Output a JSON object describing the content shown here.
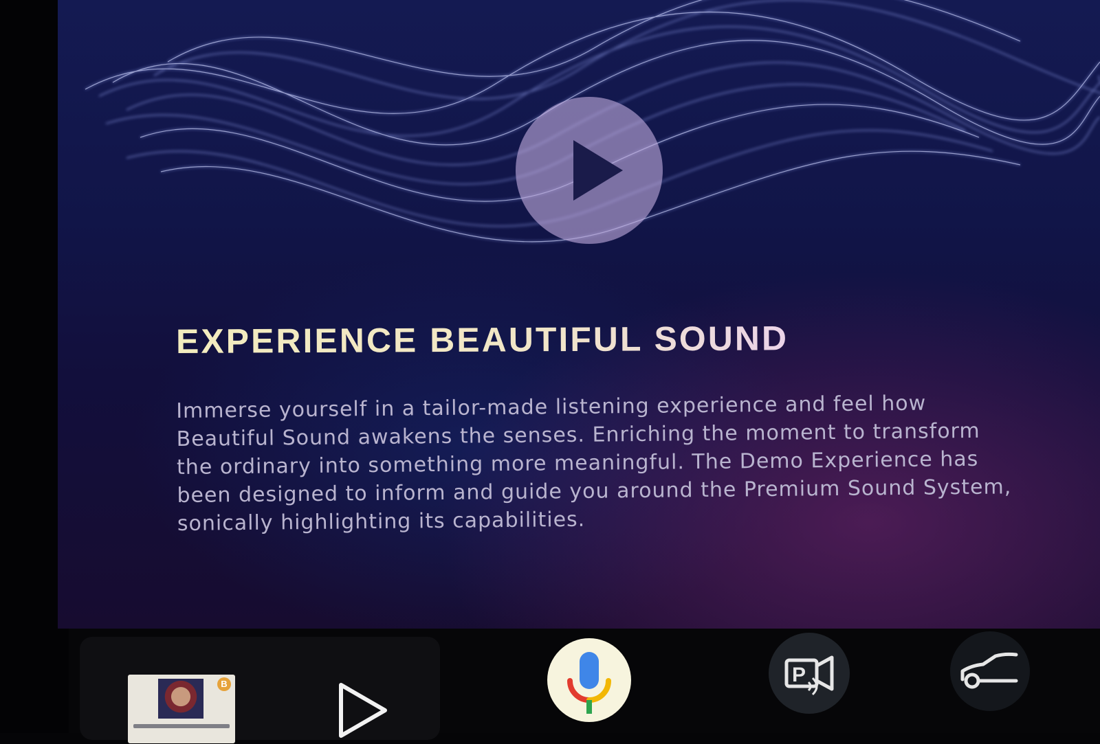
{
  "headline": "EXPERIENCE BEAUTIFUL SOUND",
  "body_lines": [
    "Immerse yourself in a tailor-made listening experience and feel how",
    "Beautiful Sound awakens the senses. Enriching the moment to transform",
    "the ordinary into something more meaningful. The Demo Experience has",
    "been designed to inform and guide you around the Premium Sound System,",
    "sonically highlighting its capabilities."
  ],
  "video": {
    "play_icon": "play-icon"
  },
  "bottom_bar": {
    "media": {
      "album_badge": "B",
      "play_icon": "play-outline-icon"
    },
    "voice_assistant_icon": "microphone-icon",
    "park_assist_icon": "park-camera-icon",
    "vehicle_icon": "car-icon"
  },
  "colors": {
    "headline_start": "#f3ecbe",
    "headline_end": "#e4c6f2",
    "body_text": "#b9b4cf",
    "play_disc": "#bea8dc",
    "mic_blue": "#3f86e8",
    "mic_red": "#e23b2e",
    "mic_yellow": "#f2b705",
    "mic_green": "#2ea44f"
  }
}
